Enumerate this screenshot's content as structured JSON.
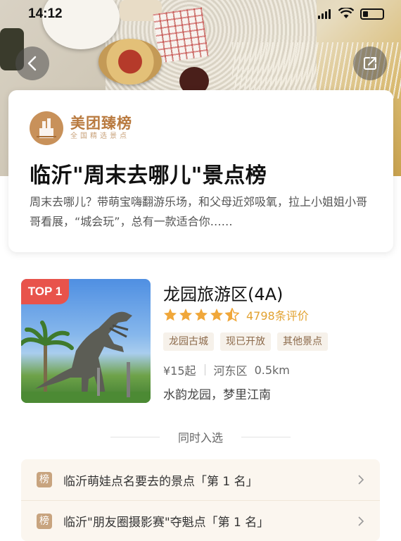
{
  "status_bar": {
    "time": "14:12",
    "icons": [
      "signal-icon",
      "wifi-icon",
      "battery-icon"
    ]
  },
  "nav": {
    "back_icon": "chevron-left-icon",
    "share_icon": "share-icon"
  },
  "header_card": {
    "brand_name": "美团臻榜",
    "brand_subtitle": "全国精选景点",
    "title": "临沂\"周末去哪儿\"景点榜",
    "description": "周末去哪儿？带萌宝嗨翻游乐场，和父母近郊吸氧，拉上小姐姐小哥哥看展，“城会玩”，总有一款适合你……"
  },
  "listing": {
    "badge": "TOP 1",
    "name": "龙园旅游区(4A)",
    "rating": 4.5,
    "review_count": "4798条评价",
    "tags": [
      "龙园古城",
      "现已开放",
      "其他景点"
    ],
    "price": "¥15起",
    "district": "河东区",
    "distance": "0.5km",
    "slogan": "水韵龙园，梦里江南"
  },
  "also_selected": {
    "label": "同时入选",
    "items": [
      {
        "icon": "榜",
        "text": "临沂萌娃点名要去的景点「第 1 名」"
      },
      {
        "icon": "榜",
        "text": "临沂\"朋友圈摄影赛\"夺魁点「第 1 名」"
      }
    ]
  },
  "colors": {
    "brand": "#b97a3f",
    "star": "#f0a73a",
    "badge": "#e8534b",
    "tag_bg": "#f6f1ea",
    "rank_bg": "#fbf6ef"
  }
}
